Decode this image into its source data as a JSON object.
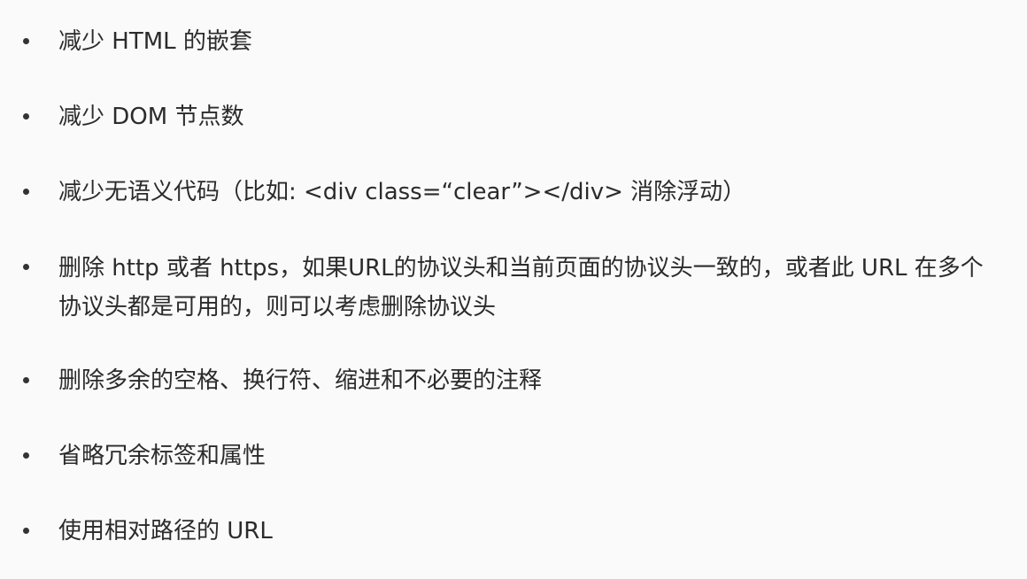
{
  "items": [
    {
      "text": "减少 HTML 的嵌套"
    },
    {
      "text": "减少 DOM 节点数"
    },
    {
      "text": "减少无语义代码（比如: <div class=“clear”></div> 消除浮动）"
    },
    {
      "text": "删除 http 或者 https，如果URL的协议头和当前页面的协议头一致的，或者此 URL 在多个协议头都是可用的，则可以考虑删除协议头"
    },
    {
      "text": "删除多余的空格、换行符、缩进和不必要的注释"
    },
    {
      "text": "省略冗余标签和属性"
    },
    {
      "text": "使用相对路径的 URL"
    }
  ]
}
